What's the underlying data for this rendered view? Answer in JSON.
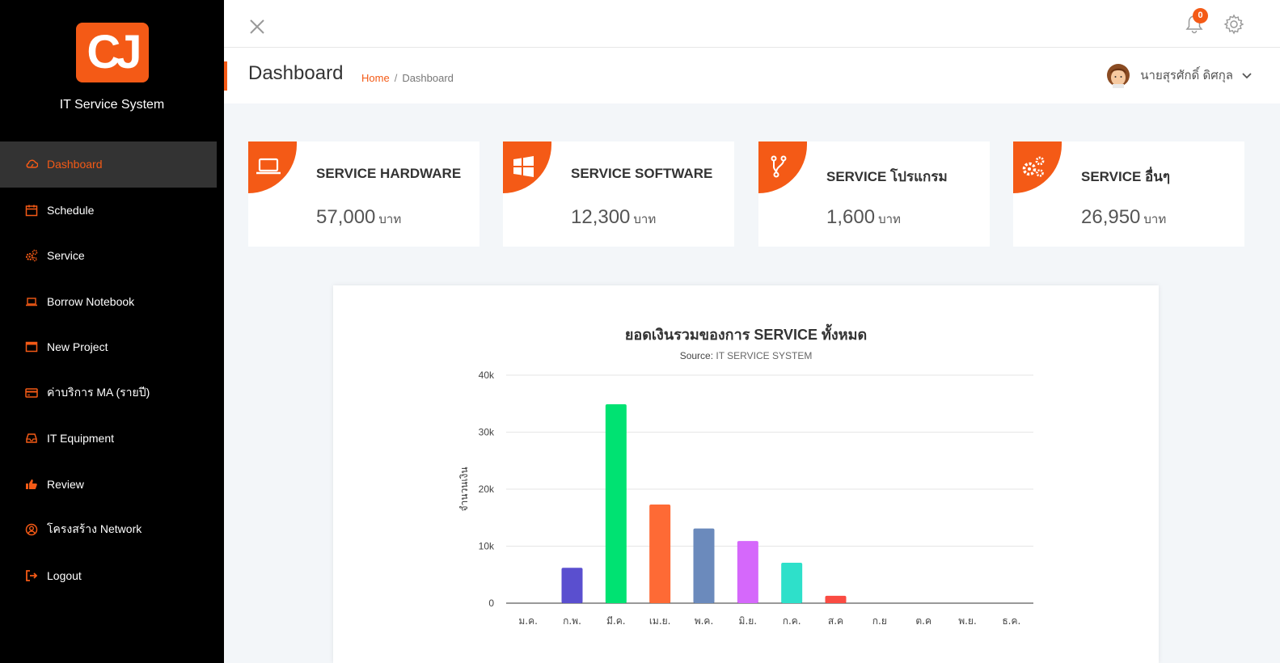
{
  "sidebar": {
    "logo_text": "CJ",
    "app_name": "IT Service System",
    "items": [
      {
        "label": "Dashboard",
        "icon": "cloud-icon",
        "active": true
      },
      {
        "label": "Schedule",
        "icon": "calendar-icon"
      },
      {
        "label": "Service",
        "icon": "gears-icon"
      },
      {
        "label": "Borrow Notebook",
        "icon": "laptop-icon"
      },
      {
        "label": "New Project",
        "icon": "window-icon"
      },
      {
        "label": "ค่าบริการ MA (รายปี)",
        "icon": "credit-card-icon"
      },
      {
        "label": "IT Equipment",
        "icon": "inbox-icon"
      },
      {
        "label": "Review",
        "icon": "thumbs-up-icon"
      },
      {
        "label": "โครงสร้าง Network",
        "icon": "user-circle-icon"
      },
      {
        "label": "Logout",
        "icon": "sign-out-icon"
      }
    ]
  },
  "topbar": {
    "notification_count": "0"
  },
  "subheader": {
    "title": "Dashboard",
    "breadcrumb_home": "Home",
    "breadcrumb_sep": "/",
    "breadcrumb_current": "Dashboard",
    "user_name": "นายสุรศักดิ์ ดิศกุล"
  },
  "cards": [
    {
      "title": "SERVICE HARDWARE",
      "value": "57,000",
      "unit": "บาท",
      "icon": "laptop-icon"
    },
    {
      "title": "SERVICE SOFTWARE",
      "value": "12,300",
      "unit": "บาท",
      "icon": "windows-icon"
    },
    {
      "title": "SERVICE โปรแกรม",
      "value": "1,600",
      "unit": "บาท",
      "icon": "code-fork-icon"
    },
    {
      "title": "SERVICE อื่นๆ",
      "value": "26,950",
      "unit": "บาท",
      "icon": "gears-icon"
    }
  ],
  "colors": {
    "accent": "#f45a16",
    "sidebar_bg": "#000000",
    "active_bg": "#333333"
  },
  "chart": {
    "title": "ยอดเงินรวมของการ SERVICE ทั้งหมด",
    "source_label": "Source:",
    "source_value": "IT SERVICE SYSTEM"
  },
  "chart_data": {
    "type": "bar",
    "title": "ยอดเงินรวมของการ SERVICE ทั้งหมด",
    "subtitle": "Source: IT SERVICE SYSTEM",
    "xlabel": "",
    "ylabel": "จำนวนเงิน",
    "categories": [
      "ม.ค.",
      "ก.พ.",
      "มี.ค.",
      "เม.ย.",
      "พ.ค.",
      "มิ.ย.",
      "ก.ค.",
      "ส.ค",
      "ก.ย",
      "ต.ค",
      "พ.ย.",
      "ธ.ค."
    ],
    "values": [
      0,
      6200,
      34900,
      17300,
      13100,
      10900,
      7100,
      1300,
      0,
      0,
      0,
      0
    ],
    "bar_colors": [
      "#5b8ff9",
      "#5a4fcf",
      "#00e272",
      "#fe6a35",
      "#6b8abc",
      "#d568fb",
      "#2ee0ca",
      "#fa4b42",
      "#feb56a",
      "#91e8e1",
      "#2caffe",
      "#544fc5"
    ],
    "yticks": [
      "0",
      "10k",
      "20k",
      "30k",
      "40k"
    ],
    "ylim": [
      0,
      40000
    ],
    "grid": true,
    "legend": "none"
  }
}
